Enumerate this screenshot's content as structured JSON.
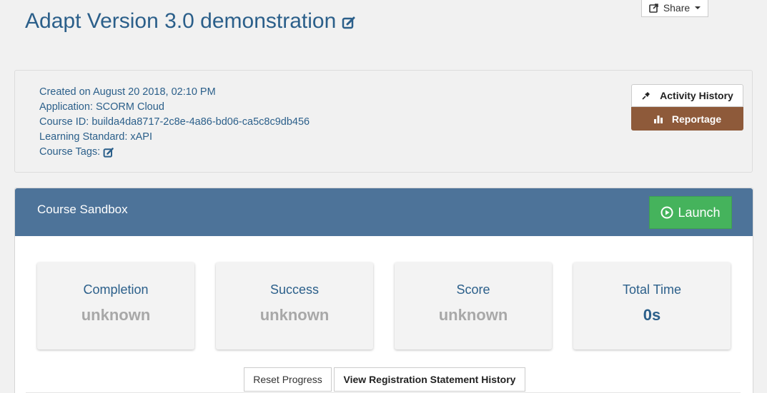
{
  "header": {
    "title": "Adapt Version 3.0 demonstration",
    "share_label": "Share"
  },
  "info": {
    "created": "Created on August 20 2018, 02:10 PM",
    "application": "Application: SCORM Cloud",
    "course_id": "Course ID: builda4da8717-2c8e-4a86-bd06-ca5c8c9db456",
    "learning_standard": "Learning Standard: xAPI",
    "course_tags": "Course Tags:"
  },
  "actions": {
    "activity_history": "Activity History",
    "reportage": "Reportage"
  },
  "sandbox": {
    "title": "Course Sandbox",
    "launch_label": "Launch",
    "stats": [
      {
        "label": "Completion",
        "value": "unknown"
      },
      {
        "label": "Success",
        "value": "unknown"
      },
      {
        "label": "Score",
        "value": "unknown"
      },
      {
        "label": "Total Time",
        "value": "0s"
      }
    ],
    "reset_label": "Reset Progress",
    "history_label": "View Registration Statement History"
  },
  "colors": {
    "title_blue": "#2b5f8a",
    "header_blue": "#4d7399",
    "launch_green": "#45b35c",
    "reportage_brown": "#8e5a3a"
  },
  "icons": [
    "edit-icon",
    "share-icon",
    "pin-icon",
    "bar-chart-icon",
    "play-circle-icon"
  ]
}
